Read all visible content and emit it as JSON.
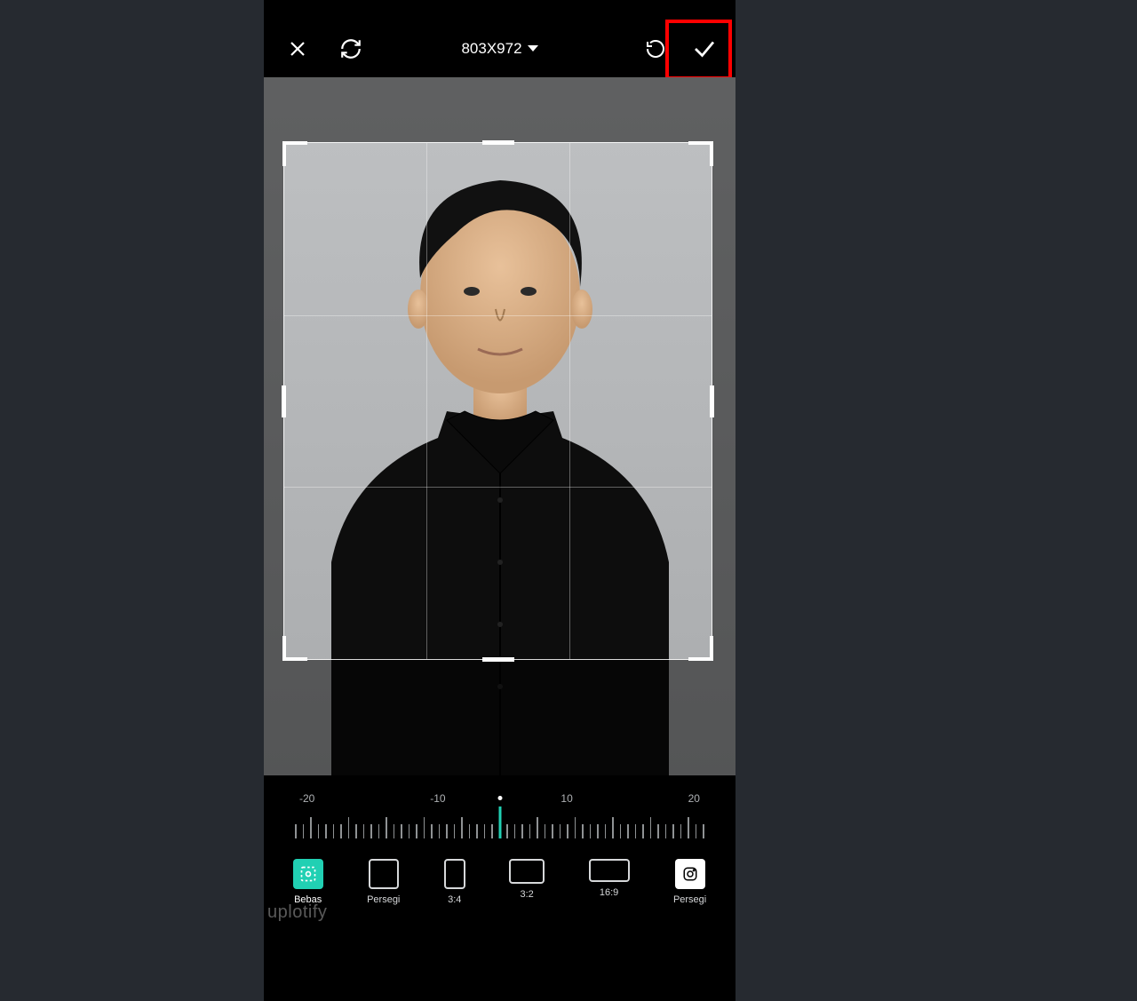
{
  "topbar": {
    "dimensions_label": "803X972"
  },
  "ruler": {
    "labels": [
      "-20",
      "-10",
      "10",
      "20"
    ]
  },
  "aspect_options": [
    {
      "name": "bebas",
      "label": "Bebas",
      "shape": "free",
      "active": true
    },
    {
      "name": "persegi",
      "label": "Persegi",
      "shape": "square",
      "active": false
    },
    {
      "name": "3-4",
      "label": "3:4",
      "shape": "portrait",
      "active": false
    },
    {
      "name": "3-2",
      "label": "3:2",
      "shape": "landscape32",
      "active": false
    },
    {
      "name": "16-9",
      "label": "16:9",
      "shape": "landscape169",
      "active": false
    },
    {
      "name": "ig",
      "label": "Persegi",
      "shape": "instagram",
      "active": false
    }
  ],
  "watermark": "uplotify"
}
